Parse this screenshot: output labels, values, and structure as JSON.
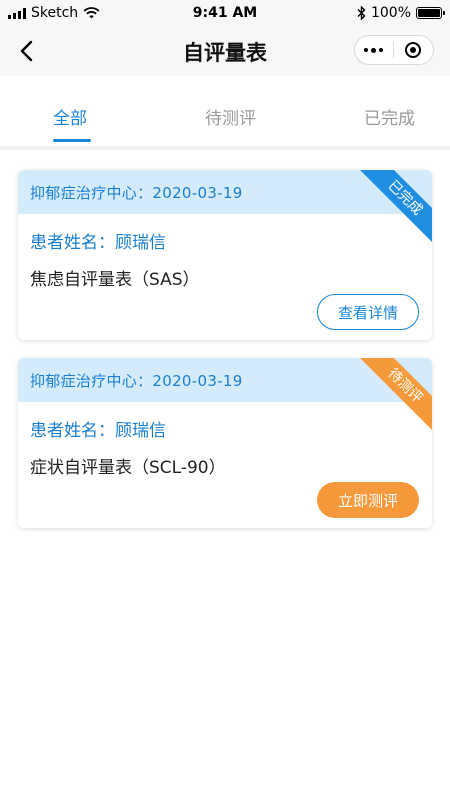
{
  "status_bar": {
    "carrier": "Sketch",
    "time": "9:41 AM",
    "battery": "100%",
    "battery_level": 1.0
  },
  "nav": {
    "title": "自评量表"
  },
  "tabs": [
    {
      "label": "全部",
      "active": true
    },
    {
      "label": "待测评",
      "active": false
    },
    {
      "label": "已完成",
      "active": false
    }
  ],
  "cards": [
    {
      "header": "抑郁症治疗中心：2020-03-19",
      "status": "已完成",
      "patient": "患者姓名：顾瑞信",
      "scale": "焦虑自评量表（SAS）",
      "action": "查看详情"
    },
    {
      "header": "抑郁症治疗中心：2020-03-19",
      "status": "待测评",
      "patient": "患者姓名：顾瑞信",
      "scale": "症状自评量表（SCL-90）",
      "action": "立即测评"
    }
  ],
  "colors": {
    "accent": "#1a86d8",
    "header_bg": "#d3ebfb",
    "completed_ribbon": "#1f8ee0",
    "pending_ribbon": "#f59a3a",
    "action_orange": "#f5993a"
  },
  "icons": {
    "back": "chevron-left-icon",
    "more": "more-dots-icon",
    "close": "target-close-icon",
    "signal": "signal-icon",
    "wifi": "wifi-icon",
    "bluetooth": "bluetooth-icon",
    "battery": "battery-icon"
  }
}
